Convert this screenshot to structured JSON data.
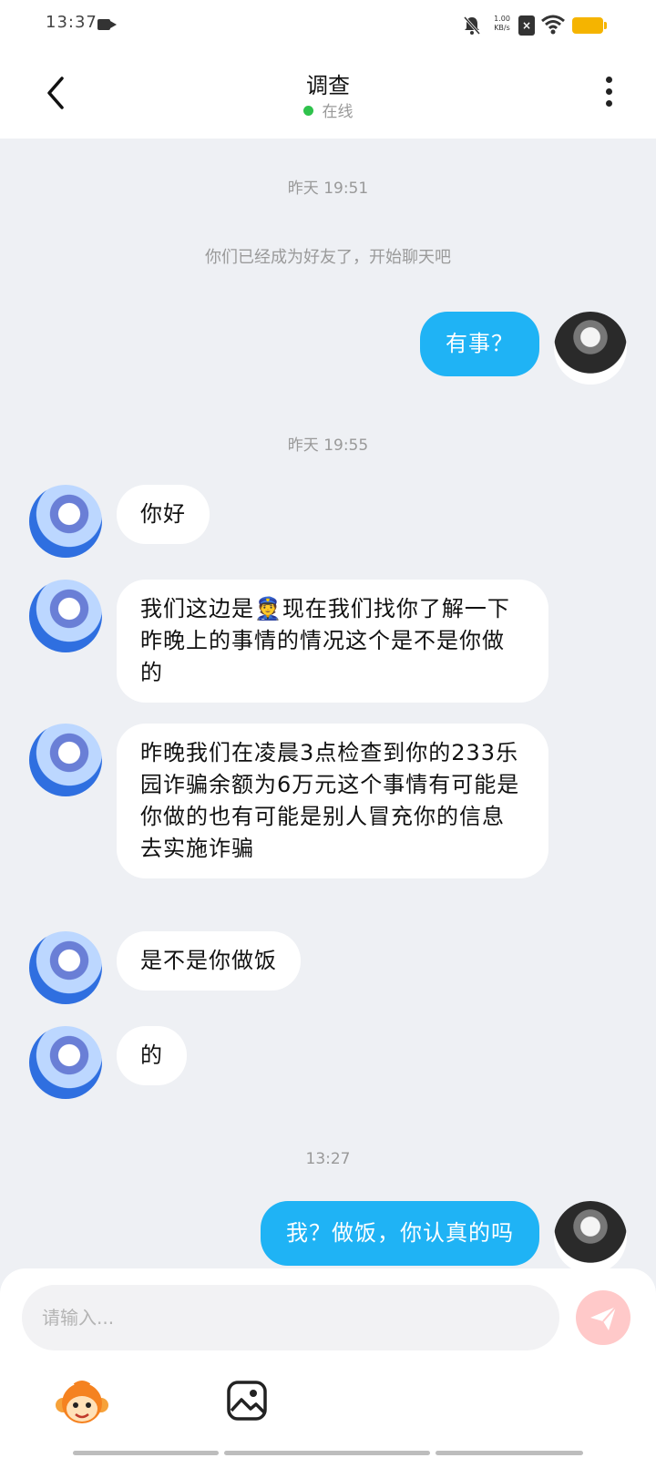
{
  "status_bar": {
    "time": "13:37",
    "net_speed_value": "1.00",
    "net_speed_unit": "KB/s"
  },
  "header": {
    "title": "调查",
    "status": "在线"
  },
  "chat": {
    "system_message": "你们已经成为好友了，开始聊天吧",
    "timestamps": [
      "昨天 19:51",
      "昨天 19:55",
      "13:27"
    ],
    "messages": [
      {
        "direction": "outgoing",
        "text": "有事？"
      },
      {
        "direction": "incoming",
        "text": "你好"
      },
      {
        "direction": "incoming",
        "text": "我们这边是👮现在我们找你了解一下昨晚上的事情的情况这个是不是你做的"
      },
      {
        "direction": "incoming",
        "text": "昨晚我们在凌晨3点检查到你的233乐园诈骗余额为6万元这个事情有可能是你做的也有可能是别人冒充你的信息去实施诈骗"
      },
      {
        "direction": "incoming",
        "text": "是不是你做饭"
      },
      {
        "direction": "incoming",
        "text": "的"
      },
      {
        "direction": "outgoing",
        "text": "我？做饭，你认真的吗"
      }
    ]
  },
  "composer": {
    "placeholder": "请输入...",
    "value": ""
  },
  "icons": {
    "back": "chevron-left-icon",
    "more": "more-vertical-icon",
    "send": "send-icon",
    "emoji": "monkey-emoji-icon",
    "image": "image-icon"
  },
  "colors": {
    "accent": "#1fb3f5",
    "online": "#2fc24c",
    "send_disabled": "#ffc9c9",
    "background": "#eef0f4"
  }
}
